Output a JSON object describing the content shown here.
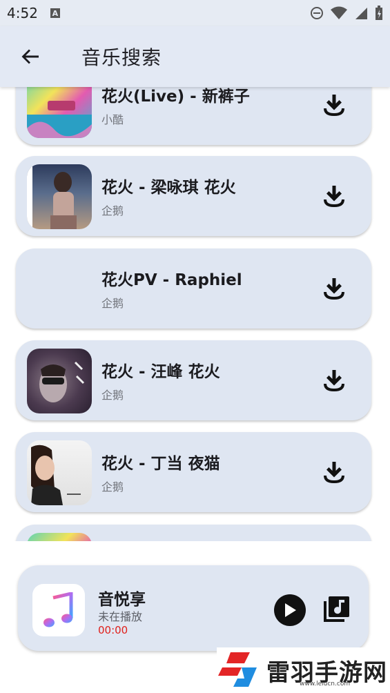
{
  "status_bar": {
    "time": "4:52"
  },
  "app_bar": {
    "title": "音乐搜索"
  },
  "songs": [
    {
      "title": "花火(Live) - 新裤子",
      "source": "小酷"
    },
    {
      "title": "花火 - 梁咏琪 花火",
      "source": "企鹅"
    },
    {
      "title": "花火PV - Raphiel",
      "source": "企鹅"
    },
    {
      "title": "花火 - 汪峰 花火",
      "source": "企鹅"
    },
    {
      "title": "花火 - 丁当 夜猫",
      "source": "企鹅"
    },
    {
      "title": "",
      "source": ""
    }
  ],
  "player": {
    "name": "音悦享",
    "status": "未在播放",
    "time": "00:00"
  },
  "watermark": {
    "text": "雷羽手游网",
    "url": "www.leiucn.com"
  },
  "colors": {
    "accent_red": "#e0201b",
    "card_bg": "#dfe6f2",
    "app_bar_bg": "#e3e9f4"
  }
}
